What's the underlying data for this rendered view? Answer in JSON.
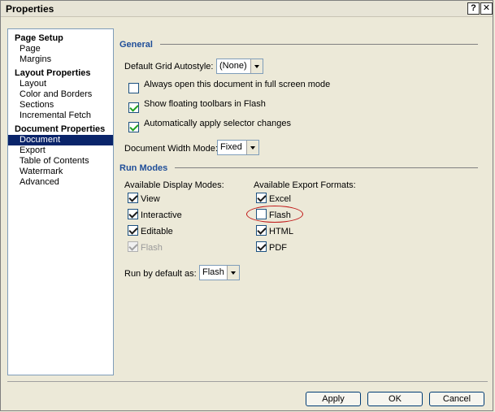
{
  "window": {
    "title": "Properties",
    "help_label": "?",
    "close_label": "✕"
  },
  "nav": {
    "groups": [
      {
        "title": "Page Setup",
        "items": [
          "Page",
          "Margins"
        ]
      },
      {
        "title": "Layout Properties",
        "items": [
          "Layout",
          "Color and Borders",
          "Sections",
          "Incremental Fetch"
        ]
      },
      {
        "title": "Document Properties",
        "items": [
          "Document",
          "Export",
          "Table of Contents",
          "Watermark",
          "Advanced"
        ]
      }
    ],
    "selected": "Document"
  },
  "general": {
    "title": "General",
    "grid_autostyle_label": "Default Grid Autostyle:",
    "grid_autostyle_value": "(None)",
    "options": [
      {
        "label": "Always open this document in full screen mode",
        "checked": false
      },
      {
        "label": "Show floating toolbars in Flash",
        "checked": true
      },
      {
        "label": "Automatically apply selector changes",
        "checked": true
      }
    ],
    "width_mode_label": "Document Width Mode:",
    "width_mode_value": "Fixed"
  },
  "run_modes": {
    "title": "Run Modes",
    "display_modes_label": "Available Display Modes:",
    "display_modes": [
      {
        "label": "View",
        "checked": true,
        "disabled": false
      },
      {
        "label": "Interactive",
        "checked": true,
        "disabled": false
      },
      {
        "label": "Editable",
        "checked": true,
        "disabled": false
      },
      {
        "label": "Flash",
        "checked": true,
        "disabled": true
      }
    ],
    "export_formats_label": "Available Export Formats:",
    "export_formats": [
      {
        "label": "Excel",
        "checked": true
      },
      {
        "label": "Flash",
        "checked": false
      },
      {
        "label": "HTML",
        "checked": true
      },
      {
        "label": "PDF",
        "checked": true
      }
    ],
    "run_default_label": "Run by default as:",
    "run_default_value": "Flash"
  },
  "buttons": {
    "apply": "Apply",
    "ok": "OK",
    "cancel": "Cancel"
  },
  "colors": {
    "selection": "#0a246a",
    "section_title": "#1f4e99",
    "highlight_ellipse": "#c01414",
    "checkmark": "#21a121"
  }
}
